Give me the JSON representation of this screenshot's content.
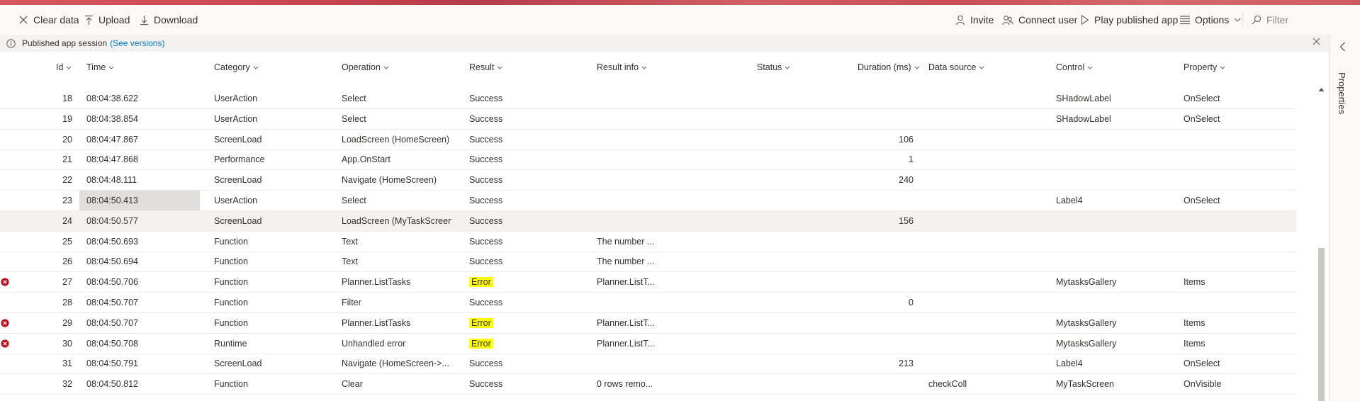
{
  "toolbar": {
    "clear_data": "Clear data",
    "upload": "Upload",
    "download": "Download",
    "invite": "Invite",
    "connect_user": "Connect user",
    "play_published_app": "Play published app",
    "options": "Options",
    "filter_placeholder": "Filter"
  },
  "infobar": {
    "message": "Published app session",
    "link": "(See versions)"
  },
  "columns": {
    "id": "Id",
    "time": "Time",
    "category": "Category",
    "operation": "Operation",
    "result": "Result",
    "result_info": "Result info",
    "status": "Status",
    "duration": "Duration (ms)",
    "data_source": "Data source",
    "control": "Control",
    "property": "Property"
  },
  "rows": [
    {
      "id": "18",
      "time": "08:04:38.622",
      "category": "UserAction",
      "operation": "Select",
      "result": "Success",
      "result_info": "",
      "status": "",
      "duration": "",
      "data_source": "",
      "control": "SHadowLabel",
      "property": "OnSelect",
      "error": false
    },
    {
      "id": "19",
      "time": "08:04:38.854",
      "category": "UserAction",
      "operation": "Select",
      "result": "Success",
      "result_info": "",
      "status": "",
      "duration": "",
      "data_source": "",
      "control": "SHadowLabel",
      "property": "OnSelect",
      "error": false
    },
    {
      "id": "20",
      "time": "08:04:47.867",
      "category": "ScreenLoad",
      "operation": "LoadScreen (HomeScreen)",
      "result": "Success",
      "result_info": "",
      "status": "",
      "duration": "106",
      "data_source": "",
      "control": "",
      "property": "",
      "error": false
    },
    {
      "id": "21",
      "time": "08:04:47.868",
      "category": "Performance",
      "operation": "App.OnStart",
      "result": "Success",
      "result_info": "",
      "status": "",
      "duration": "1",
      "data_source": "",
      "control": "",
      "property": "",
      "error": false
    },
    {
      "id": "22",
      "time": "08:04:48.111",
      "category": "ScreenLoad",
      "operation": "Navigate (HomeScreen)",
      "result": "Success",
      "result_info": "",
      "status": "",
      "duration": "240",
      "data_source": "",
      "control": "",
      "property": "",
      "error": false
    },
    {
      "id": "23",
      "time": "08:04:50.413",
      "category": "UserAction",
      "operation": "Select",
      "result": "Success",
      "result_info": "",
      "status": "",
      "duration": "",
      "data_source": "",
      "control": "Label4",
      "property": "OnSelect",
      "error": false
    },
    {
      "id": "24",
      "time": "08:04:50.577",
      "category": "ScreenLoad",
      "operation": "LoadScreen (MyTaskScreen)",
      "result": "Success",
      "result_info": "",
      "status": "",
      "duration": "156",
      "data_source": "",
      "control": "",
      "property": "",
      "error": false
    },
    {
      "id": "25",
      "time": "08:04:50.693",
      "category": "Function",
      "operation": "Text",
      "result": "Success",
      "result_info": "The number ...",
      "status": "",
      "duration": "",
      "data_source": "",
      "control": "",
      "property": "",
      "error": false
    },
    {
      "id": "26",
      "time": "08:04:50.694",
      "category": "Function",
      "operation": "Text",
      "result": "Success",
      "result_info": "The number ...",
      "status": "",
      "duration": "",
      "data_source": "",
      "control": "",
      "property": "",
      "error": false
    },
    {
      "id": "27",
      "time": "08:04:50.706",
      "category": "Function",
      "operation": "Planner.ListTasks",
      "result": "Error",
      "result_info": "Planner.ListT...",
      "status": "",
      "duration": "",
      "data_source": "",
      "control": "MytasksGallery",
      "property": "Items",
      "error": true
    },
    {
      "id": "28",
      "time": "08:04:50.707",
      "category": "Function",
      "operation": "Filter",
      "result": "Success",
      "result_info": "",
      "status": "",
      "duration": "0",
      "data_source": "",
      "control": "",
      "property": "",
      "error": false
    },
    {
      "id": "29",
      "time": "08:04:50.707",
      "category": "Function",
      "operation": "Planner.ListTasks",
      "result": "Error",
      "result_info": "Planner.ListT...",
      "status": "",
      "duration": "",
      "data_source": "",
      "control": "MytasksGallery",
      "property": "Items",
      "error": true
    },
    {
      "id": "30",
      "time": "08:04:50.708",
      "category": "Runtime",
      "operation": "Unhandled error",
      "result": "Error",
      "result_info": "Planner.ListT...",
      "status": "",
      "duration": "",
      "data_source": "",
      "control": "MytasksGallery",
      "property": "Items",
      "error": true
    },
    {
      "id": "31",
      "time": "08:04:50.791",
      "category": "ScreenLoad",
      "operation": "Navigate (HomeScreen->...",
      "result": "Success",
      "result_info": "",
      "status": "",
      "duration": "213",
      "data_source": "",
      "control": "Label4",
      "property": "OnSelect",
      "error": false
    },
    {
      "id": "32",
      "time": "08:04:50.812",
      "category": "Function",
      "operation": "Clear",
      "result": "Success",
      "result_info": "0 rows remo...",
      "status": "",
      "duration": "",
      "data_source": "checkColl",
      "control": "MyTaskScreen",
      "property": "OnVisible",
      "error": false
    }
  ],
  "selected_row_index": 6,
  "highlighted_time_row_index": 5,
  "right_panel": {
    "label": "Properties"
  },
  "colors": {
    "error_highlight": "#ffff00",
    "error_icon": "#c50f1f",
    "link": "#0078d4",
    "banner": "#c9474f"
  },
  "icons": {
    "clear_data": "close-icon",
    "upload": "upload-icon",
    "download": "download-icon",
    "invite": "person-icon",
    "connect_user": "people-icon",
    "play": "play-icon",
    "options": "list-icon",
    "filter": "filter-icon",
    "info": "info-icon",
    "error": "error-circle-icon"
  }
}
